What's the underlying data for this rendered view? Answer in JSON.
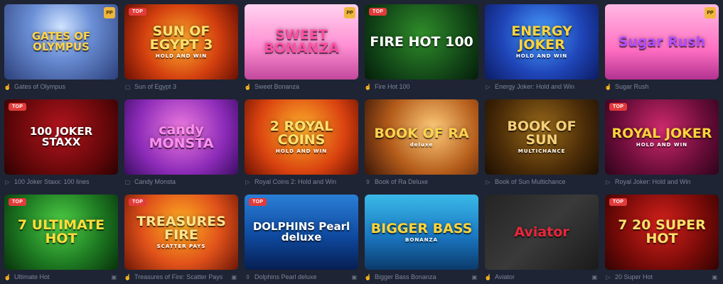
{
  "badges": {
    "top": "TOP",
    "provider": "PP"
  },
  "games": [
    {
      "title": "Gates of Olympus",
      "logo": "GATES OF OLYMPUS",
      "sub": "",
      "top": false,
      "provider": true,
      "bg": "bg-olympus",
      "logo_color": "#ffd24a",
      "caption_icon": "hand-icon",
      "right_icon": ""
    },
    {
      "title": "Sun of Egypt 3",
      "logo": "SUN OF EGYPT 3",
      "sub": "HOLD AND WIN",
      "top": true,
      "provider": false,
      "bg": "bg-egypt",
      "logo_color": "#ffe06b",
      "caption_icon": "square-icon",
      "right_icon": ""
    },
    {
      "title": "Sweet Bonanza",
      "logo": "SWEET BONANZA",
      "sub": "",
      "top": false,
      "provider": true,
      "bg": "bg-sweet",
      "logo_color": "#ff4fa4",
      "caption_icon": "hand-icon",
      "right_icon": ""
    },
    {
      "title": "Fire Hot 100",
      "logo": "FIRE HOT 100",
      "sub": "",
      "top": true,
      "provider": false,
      "bg": "bg-firehot",
      "logo_color": "#ffffff",
      "caption_icon": "hand-icon",
      "right_icon": ""
    },
    {
      "title": "Energy Joker: Hold and Win",
      "logo": "ENERGY JOKER",
      "sub": "HOLD AND WIN",
      "top": false,
      "provider": false,
      "bg": "bg-energy",
      "logo_color": "#ffd43a",
      "caption_icon": "play-icon",
      "right_icon": ""
    },
    {
      "title": "Sugar Rush",
      "logo": "Sugar Rush",
      "sub": "",
      "top": false,
      "provider": true,
      "bg": "bg-sugar",
      "logo_color": "#b44cff",
      "caption_icon": "hand-icon",
      "right_icon": ""
    },
    {
      "title": "100 Joker Staxx: 100 lines",
      "logo": "100 JOKER STAXX",
      "sub": "",
      "top": true,
      "provider": false,
      "bg": "bg-joker100",
      "logo_color": "#ffffff",
      "caption_icon": "play-icon",
      "right_icon": ""
    },
    {
      "title": "Candy Monsta",
      "logo": "candy MONSTA",
      "sub": "",
      "top": false,
      "provider": false,
      "bg": "bg-candy",
      "logo_color": "#ff8df0",
      "caption_icon": "square-icon",
      "right_icon": ""
    },
    {
      "title": "Royal Coins 2: Hold and Win",
      "logo": "2 ROYAL COINS",
      "sub": "HOLD AND WIN",
      "top": false,
      "provider": false,
      "bg": "bg-royalcoins",
      "logo_color": "#ffe06b",
      "caption_icon": "play-icon",
      "right_icon": ""
    },
    {
      "title": "Book of Ra Deluxe",
      "logo": "BOOK OF RA",
      "sub": "deluxe",
      "top": false,
      "provider": false,
      "bg": "bg-bookra",
      "logo_color": "#ffd34d",
      "caption_icon": "g-icon",
      "right_icon": ""
    },
    {
      "title": "Book of Sun Multichance",
      "logo": "BOOK OF SUN",
      "sub": "MULTICHANCE",
      "top": false,
      "provider": false,
      "bg": "bg-booksun",
      "logo_color": "#f5d07a",
      "caption_icon": "play-icon",
      "right_icon": ""
    },
    {
      "title": "Royal Joker: Hold and Win",
      "logo": "ROYAL JOKER",
      "sub": "HOLD AND WIN",
      "top": true,
      "provider": false,
      "bg": "bg-royaljoker",
      "logo_color": "#ffd43a",
      "caption_icon": "play-icon",
      "right_icon": ""
    },
    {
      "title": "Ultimate Hot",
      "logo": "7 ULTIMATE HOT",
      "sub": "",
      "top": true,
      "provider": false,
      "bg": "bg-ultimate",
      "logo_color": "#ffde3b",
      "caption_icon": "hand-icon",
      "right_icon": "video-icon"
    },
    {
      "title": "Treasures of Fire: Scatter Pays",
      "logo": "TREASURES FIRE",
      "sub": "SCATTER PAYS",
      "top": true,
      "provider": false,
      "bg": "bg-treasures",
      "logo_color": "#ffe38a",
      "caption_icon": "hand-icon",
      "right_icon": "video-icon"
    },
    {
      "title": "Dolphins Pearl deluxe",
      "logo": "DOLPHINS Pearl deluxe",
      "sub": "",
      "top": true,
      "provider": false,
      "bg": "bg-dolphins",
      "logo_color": "#ffffff",
      "caption_icon": "g-icon",
      "right_icon": "video-icon"
    },
    {
      "title": "Bigger Bass Bonanza",
      "logo": "BIGGER BASS",
      "sub": "BONANZA",
      "top": false,
      "provider": false,
      "bg": "bg-bass",
      "logo_color": "#ffd43a",
      "caption_icon": "hand-icon",
      "right_icon": "video-icon"
    },
    {
      "title": "Aviator",
      "logo": "Aviator",
      "sub": "",
      "top": false,
      "provider": false,
      "bg": "bg-aviator",
      "logo_color": "#e8263a",
      "caption_icon": "hand-icon",
      "right_icon": "video-icon"
    },
    {
      "title": "20 Super Hot",
      "logo": "7 20 SUPER HOT",
      "sub": "",
      "top": true,
      "provider": false,
      "bg": "bg-superhot",
      "logo_color": "#ffe06b",
      "caption_icon": "play-icon",
      "right_icon": "video-icon"
    }
  ]
}
